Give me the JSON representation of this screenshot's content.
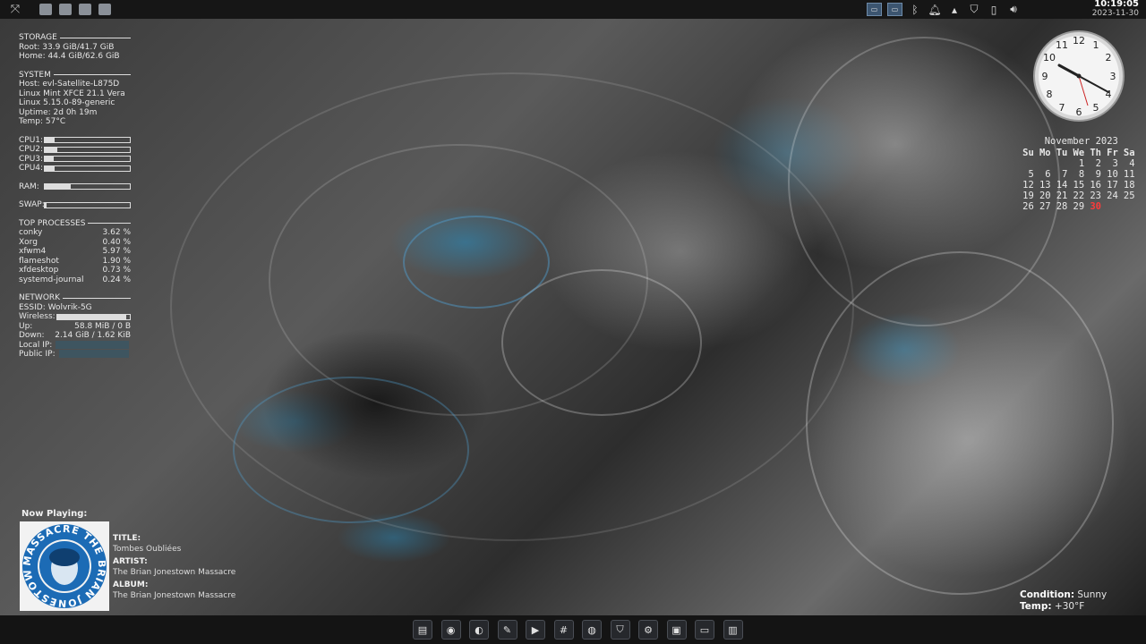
{
  "top_panel": {
    "time": "10:19:05",
    "date": "2023-11-30",
    "launchers": [
      "whisker-menu-icon",
      "terminal-icon",
      "file-manager-icon",
      "screenshot-icon",
      "media-icon"
    ],
    "tray": [
      "workspace-1-icon",
      "workspace-2-icon",
      "bluetooth-icon",
      "notification-icon",
      "network-icon",
      "shield-icon",
      "battery-icon",
      "volume-icon"
    ]
  },
  "conky": {
    "storage_header": "STORAGE",
    "root": "Root:  33.9 GiB/41.7 GiB",
    "home": "Home:  44.4 GiB/62.6 GiB",
    "system_header": "SYSTEM",
    "host": "Host: evl-Satellite-L875D",
    "distro": "Linux Mint XFCE 21.1 Vera",
    "kernel": "Linux 5.15.0-89-generic",
    "uptime": "Uptime: 2d 0h 19m",
    "temp": "Temp: 57°C",
    "cpus": [
      {
        "label": "CPU1:",
        "level": 0.12
      },
      {
        "label": "CPU2:",
        "level": 0.15
      },
      {
        "label": "CPU3:",
        "level": 0.1
      },
      {
        "label": "CPU4:",
        "level": 0.12
      }
    ],
    "ram_label": "RAM:",
    "ram_level": 0.3,
    "swap_label": "SWAP:",
    "swap_level": 0.02,
    "top_header": "TOP PROCESSES",
    "processes": [
      {
        "name": "conky",
        "cpu": "3.62 %"
      },
      {
        "name": "Xorg",
        "cpu": "0.40 %"
      },
      {
        "name": "xfwm4",
        "cpu": "5.97 %"
      },
      {
        "name": "flameshot",
        "cpu": "1.90 %"
      },
      {
        "name": "xfdesktop",
        "cpu": "0.73 %"
      },
      {
        "name": "systemd-journal",
        "cpu": "0.24 %"
      }
    ],
    "network_header": "NETWORK",
    "essid": "ESSID: Wolvrik-5G",
    "wireless_label": "Wireless:",
    "wireless_level": 0.95,
    "up_label": "Up:",
    "up_value": "58.8 MiB / 0 B",
    "down_label": "Down:",
    "down_value": "2.14 GiB / 1.62 KiB",
    "local_ip_label": "Local IP:",
    "public_ip_label": "Public IP:"
  },
  "calendar": {
    "title": "November 2023",
    "weekdays": [
      "Su",
      "Mo",
      "Tu",
      "We",
      "Th",
      "Fr",
      "Sa"
    ],
    "days": [
      "",
      "",
      "",
      "1",
      "2",
      "3",
      "4",
      "5",
      "6",
      "7",
      "8",
      "9",
      "10",
      "11",
      "12",
      "13",
      "14",
      "15",
      "16",
      "17",
      "18",
      "19",
      "20",
      "21",
      "22",
      "23",
      "24",
      "25",
      "26",
      "27",
      "28",
      "29",
      "30",
      "",
      ""
    ],
    "today": "30",
    "today_color": "#ff3b3b"
  },
  "now_playing": {
    "heading": "Now Playing:",
    "title_label": "TITLE:",
    "title": "Tombes Oubliées",
    "artist_label": "ARTIST:",
    "artist": "The Brian Jonestown Massacre",
    "album_label": "ALBUM:",
    "album": "The Brian Jonestown Massacre",
    "album_art_text": "MASSACRE THE BRIAN JONESTOWN",
    "album_art_color": "#1c6bb5"
  },
  "weather": {
    "condition_label": "Condition:",
    "condition": "Sunny",
    "temp_label": "Temp:",
    "temp": "+30°F"
  },
  "dock": {
    "items": [
      "files-icon",
      "chrome-icon",
      "browser-icon",
      "editor-icon",
      "video-icon",
      "settings-grid-icon",
      "qbittorrent-icon",
      "bitwarden-icon",
      "gear-icon",
      "monitor-icon",
      "workspace-icon",
      "trash-icon"
    ]
  }
}
